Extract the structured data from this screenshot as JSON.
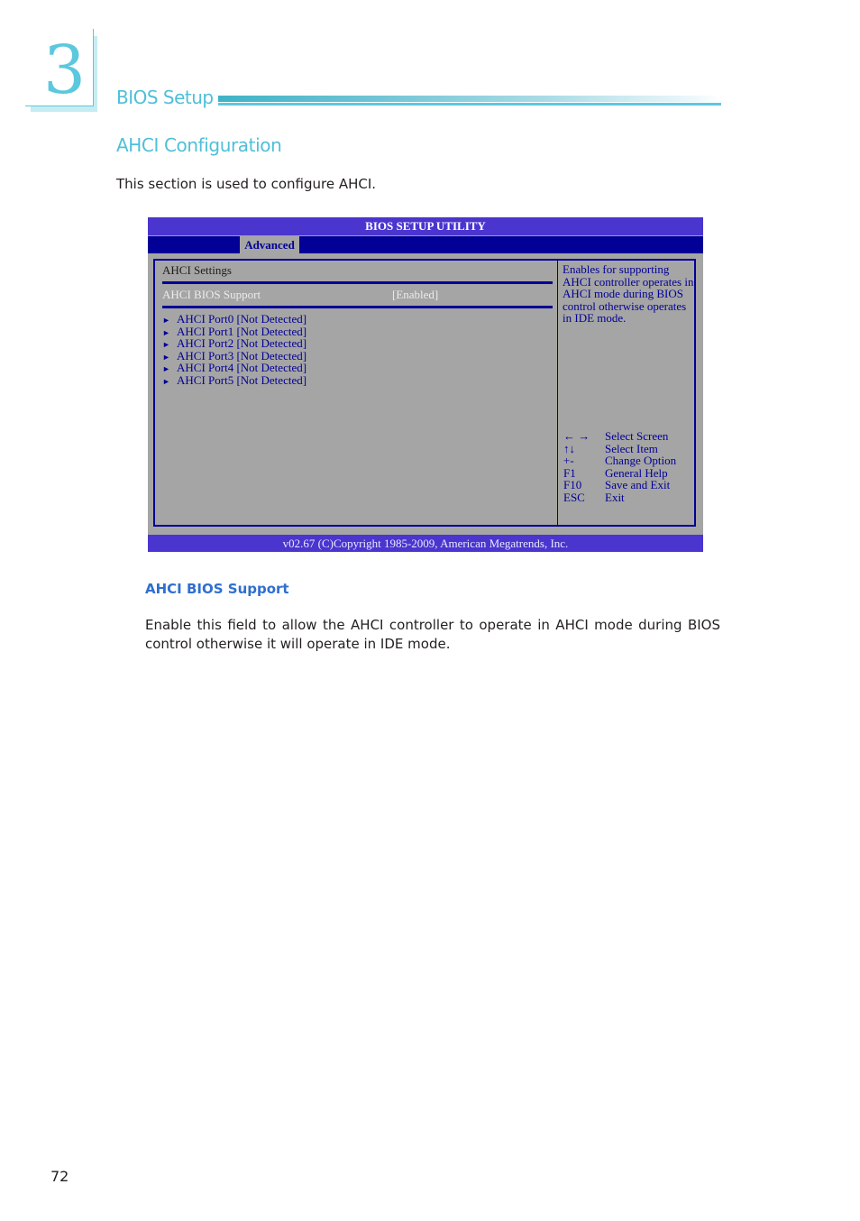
{
  "header": {
    "chapter_number": "3",
    "chapter_title": "BIOS Setup"
  },
  "section": {
    "title": "AHCI Configuration",
    "intro": "This section is used to configure AHCI."
  },
  "bios": {
    "title": "BIOS SETUP UTILITY",
    "active_tab": "Advanced",
    "settings_label": "AHCI Settings",
    "support": {
      "label": "AHCI BIOS Support",
      "value": "[Enabled]"
    },
    "ports": [
      {
        "label": "AHCI Port0 [Not Detected]"
      },
      {
        "label": "AHCI Port1 [Not Detected]"
      },
      {
        "label": "AHCI Port2 [Not Detected]"
      },
      {
        "label": "AHCI Port3 [Not Detected]"
      },
      {
        "label": "AHCI Port4 [Not Detected]"
      },
      {
        "label": "AHCI Port5 [Not Detected]"
      }
    ],
    "submenu_arrow_icon": "►",
    "help_text": "Enables for supporting AHCI controller operates in AHCI mode during BIOS control otherwise operates in IDE mode.",
    "keys": [
      {
        "key": "← →",
        "action": "Select Screen"
      },
      {
        "key": "↑↓",
        "action": "Select Item"
      },
      {
        "key": "+-",
        "action": "Change Option"
      },
      {
        "key": "F1",
        "action": "General Help"
      },
      {
        "key": "F10",
        "action": "Save and Exit"
      },
      {
        "key": "ESC",
        "action": "Exit"
      }
    ],
    "footer": "v02.67 (C)Copyright 1985-2009, American Megatrends, Inc.",
    "colors": {
      "title_bar": "#4a35cf",
      "tab_bar": "#020096",
      "panel": "#a5a5a5",
      "highlight_text": "#ececec"
    }
  },
  "field_help": {
    "heading": "AHCI BIOS Support",
    "text": "Enable this field to allow the AHCI controller to operate in AHCI mode during BIOS control otherwise it will operate in IDE mode."
  },
  "page_number": "72",
  "theme": {
    "accent": "#4fbfd9",
    "subheading": "#2e6fd0"
  }
}
